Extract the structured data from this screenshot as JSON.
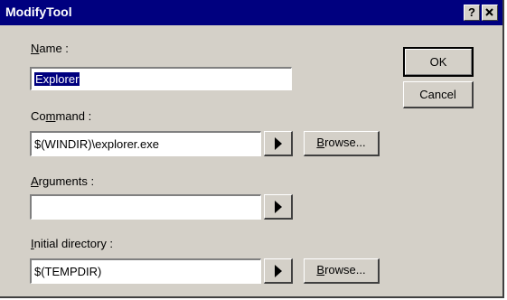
{
  "window": {
    "title": "ModifyTool",
    "help_label": "?",
    "close_label": "x"
  },
  "fields": {
    "name": {
      "label_acc": "N",
      "label_rest": "ame :",
      "value": "Explorer"
    },
    "command": {
      "label_pre": "Co",
      "label_acc": "m",
      "label_rest": "mand :",
      "value": "$(WINDIR)\\explorer.exe"
    },
    "arguments": {
      "label_acc": "A",
      "label_rest": "rguments :",
      "value": ""
    },
    "initial_directory": {
      "label_acc": "I",
      "label_rest": "nitial directory :",
      "value": "$(TEMPDIR)"
    }
  },
  "buttons": {
    "ok": "OK",
    "cancel": "Cancel",
    "browse_acc": "B",
    "browse_rest": "rowse..."
  },
  "colors": {
    "titlebar": "#00007f",
    "face": "#d4d0c8"
  }
}
